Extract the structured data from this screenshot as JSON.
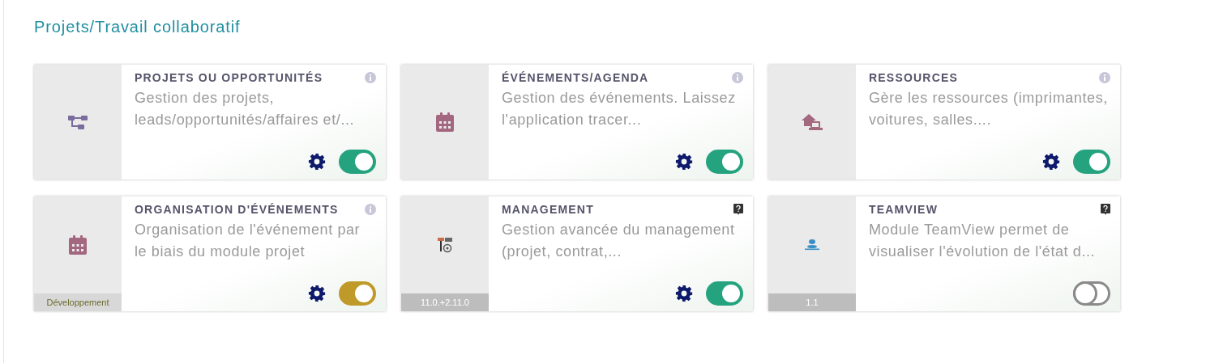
{
  "section_title": "Projets/Travail collaboratif",
  "modules": [
    {
      "kind": "core",
      "name": "PROJETS OU OPPORTUNITÉS",
      "description": "Gestion des projets, leads/opportunités/affaires et/...",
      "settings": true,
      "switch": {
        "on": true,
        "color": "#25a37e"
      }
    },
    {
      "kind": "core",
      "name": "ÉVÉNEMENTS/AGENDA",
      "description": "Gestion des événements. Laissez l'application tracer...",
      "settings": true,
      "switch": {
        "on": true,
        "color": "#25a37e"
      }
    },
    {
      "kind": "core",
      "name": "RESSOURCES",
      "description": "Gère les ressources (imprimantes, voitures, salles....",
      "settings": true,
      "switch": {
        "on": true,
        "color": "#25a37e"
      }
    },
    {
      "kind": "core",
      "name": "ORGANISATION D'ÉVÉNEMENTS",
      "description": "Organisation de l'événement par le biais du module projet",
      "badge": {
        "kind": "development",
        "text": "Développement"
      },
      "settings": true,
      "switch": {
        "on": true,
        "color": "#bf9a2a"
      }
    },
    {
      "kind": "external",
      "name": "MANAGEMENT",
      "description": "Gestion avancée du management (projet, contrat,...",
      "badge": {
        "kind": "version",
        "text": "11.0.+2.11.0"
      },
      "settings": true,
      "switch": {
        "on": true,
        "color": "#25a37e"
      }
    },
    {
      "kind": "external",
      "name": "TEAMVIEW",
      "description": "Module TeamView permet de visualiser l'évolution de l'état d...",
      "badge": {
        "kind": "version",
        "text": "1.1"
      },
      "settings": false,
      "switch": {
        "on": false,
        "color": "#8a8a8a"
      }
    }
  ]
}
